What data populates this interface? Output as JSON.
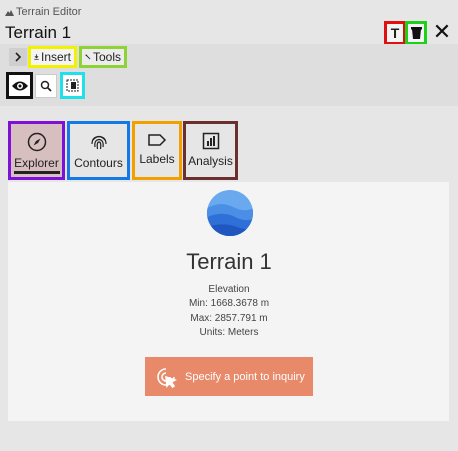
{
  "app": {
    "label": "Terrain Editor"
  },
  "document": {
    "title": "Terrain 1"
  },
  "toolbar": {
    "insert_label": "Insert",
    "tools_label": "Tools"
  },
  "header_buttons": {
    "text_label": "T",
    "close_label": "✕"
  },
  "tabs": [
    {
      "label": "Explorer"
    },
    {
      "label": "Contours"
    },
    {
      "label": "Labels"
    },
    {
      "label": "Analysis"
    }
  ],
  "explorer": {
    "terrain_name": "Terrain 1",
    "elevation_label": "Elevation",
    "min": "Min: 1668.3678 m",
    "max": "Max: 2857.791 m",
    "units": "Units: Meters",
    "inquiry_label": "Specify a point to inquiry"
  },
  "colors": {
    "accent": "#e88a6a",
    "highlight_insert": "#f2f200",
    "highlight_tools": "#8fd236",
    "highlight_eye": "#111111",
    "highlight_panel": "#22e0ea",
    "highlight_t": "#e01010",
    "highlight_layers": "#19d219",
    "highlight_explorer": "#7f10d8",
    "highlight_contours": "#1478e6",
    "highlight_labels": "#f0a000",
    "highlight_analysis": "#6b2f2f"
  }
}
